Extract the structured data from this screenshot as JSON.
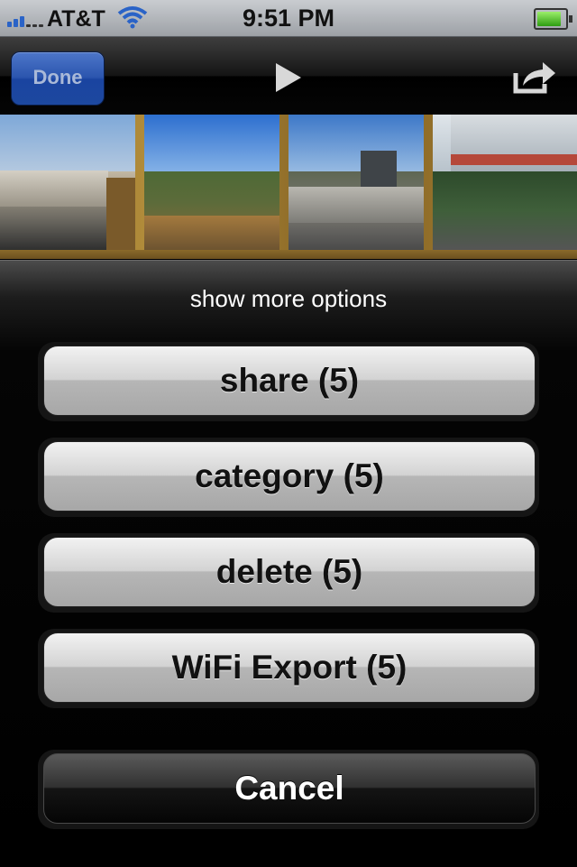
{
  "status_bar": {
    "carrier": "AT&T",
    "time": "9:51 PM",
    "battery_level": 0.85,
    "signal_bars": 3,
    "signal_color": "#2a63c7"
  },
  "toolbar": {
    "done_label": "Done",
    "play_icon": "play-icon",
    "share_icon": "share-export-icon"
  },
  "photos": [
    {
      "sky": "#5f8fc7",
      "ground": "#8c8677"
    },
    {
      "sky": "#3f7fd1",
      "ground": "#6f7a3e"
    },
    {
      "sky": "#4c83c9",
      "ground": "#8e8d86"
    },
    {
      "sky": "#c9d4de",
      "ground": "#3d5a38"
    }
  ],
  "sheet": {
    "title": "show more options",
    "buttons": [
      {
        "label": "share (5)"
      },
      {
        "label": "category (5)"
      },
      {
        "label": "delete (5)"
      },
      {
        "label": "WiFi Export (5)"
      }
    ],
    "cancel_label": "Cancel"
  }
}
